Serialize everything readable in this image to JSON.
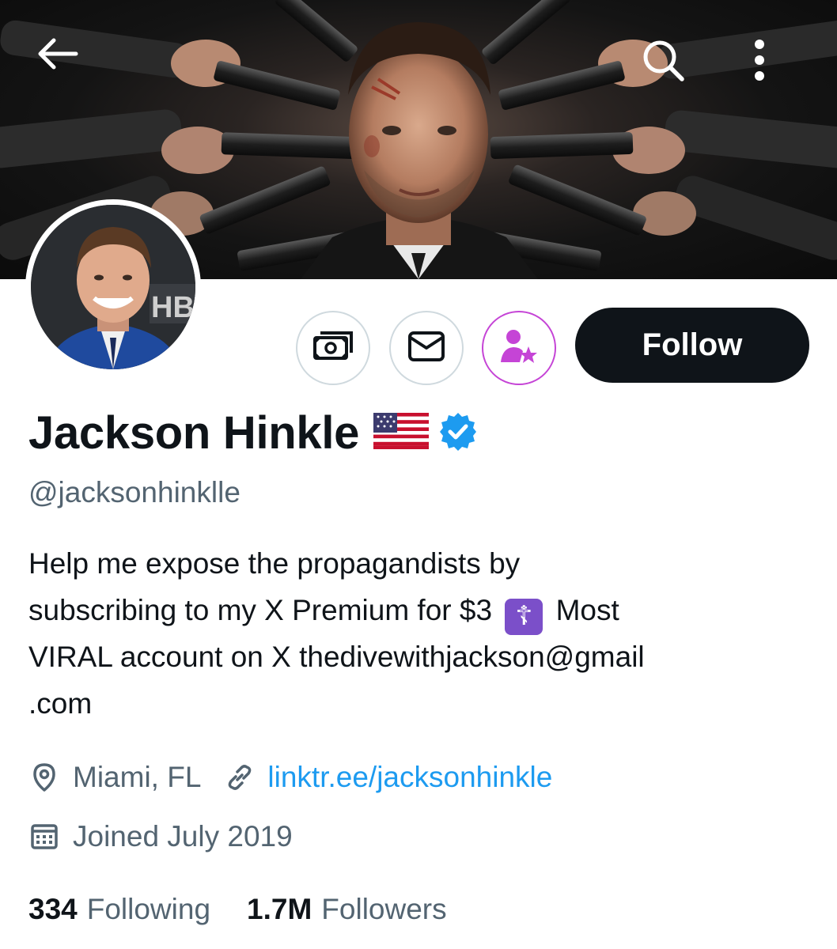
{
  "header": {
    "back_icon": "arrow-left-icon",
    "search_icon": "search-icon",
    "more_icon": "more-vertical-icon"
  },
  "banner": {
    "description_icon": "banner-image"
  },
  "avatar": {
    "logo_text": "HB"
  },
  "actions": {
    "tip_icon": "money-icon",
    "message_icon": "envelope-icon",
    "subscribe_icon": "person-star-icon",
    "follow_label": "Follow"
  },
  "profile": {
    "name": "Jackson Hinkle",
    "flag_icon": "us-flag-icon",
    "verified_icon": "verified-badge-icon",
    "handle": "@jacksonhinklle",
    "bio_lines": [
      "Help me expose the propagandists by",
      "subscribing to my X Premium for $3",
      "Most",
      "VIRAL account on X  thedivewithjackson@gmail",
      ".com"
    ],
    "bio_emoji": "☦",
    "location": "Miami, FL",
    "link": "linktr.ee/jacksonhinkle",
    "joined": "Joined July 2019"
  },
  "stats": {
    "following_count": "334",
    "following_label": "Following",
    "followers_count": "1.7M",
    "followers_label": "Followers"
  },
  "colors": {
    "accent_link": "#1d9bf0",
    "follow_bg": "#0f1419",
    "secondary_text": "#536471",
    "subscribe_accent": "#c544d6",
    "verified": "#1d9bf0"
  }
}
